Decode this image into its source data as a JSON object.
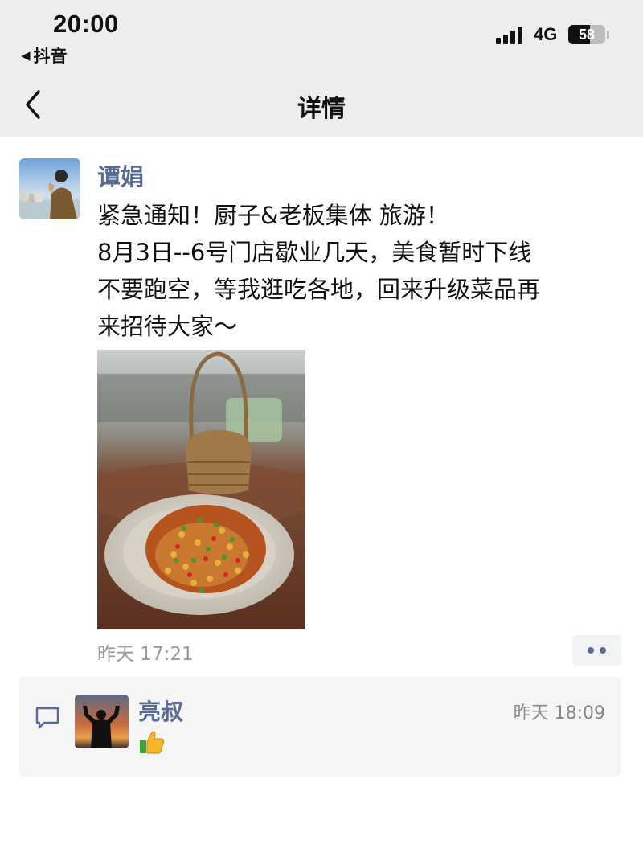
{
  "status_bar": {
    "time": "20:00",
    "back_app": "抖音",
    "network": "4G",
    "battery_percent": "58",
    "battery_level": 0.58
  },
  "nav": {
    "title": "详情"
  },
  "post": {
    "author": "谭娟",
    "text_lines": [
      "紧急通知！厨子&老板集体 旅游！",
      "8月3日--6号门店歇业几天，美食暂时下线",
      "不要跑空，等我逛吃各地，回来升级菜品再",
      "来招待大家～"
    ],
    "time": "昨天 17:21"
  },
  "comment": {
    "author": "亮叔",
    "time": "昨天 18:09",
    "content_icon": "thumbs-up-emoji"
  },
  "colors": {
    "link_blue": "#576b95",
    "bar_gray": "#ededed",
    "comment_bg": "#f5f5f5",
    "secondary_text": "#999999"
  }
}
